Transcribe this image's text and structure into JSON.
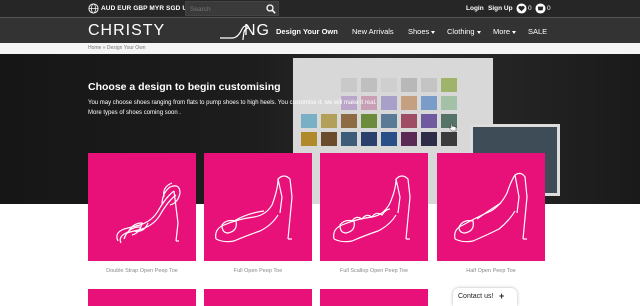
{
  "topbar": {
    "currencies": "AUD EUR GBP MYR SGD USD",
    "search_placeholder": "Search",
    "login": "Login",
    "signup": "Sign Up",
    "wishlist_count": "0",
    "cart_count": "0"
  },
  "brand": {
    "logo_prefix": "CHRISTY",
    "logo_suffix": "NG"
  },
  "nav": {
    "items": [
      {
        "label": "Design Your Own",
        "active": true
      },
      {
        "label": "New Arrivals"
      },
      {
        "label": "Shoes"
      },
      {
        "label": "Clothing"
      },
      {
        "label": "More"
      },
      {
        "label": "SALE"
      }
    ]
  },
  "breadcrumb": "Home » Design Your Own",
  "hero": {
    "title": "Choose a design to begin customising",
    "text": "You may choose shoes ranging from flats to pump shoes to high heels. You customise it, we will make it real. More types of shoes coming soon ."
  },
  "designs": [
    {
      "label": "Double Strap Open Peep Toe",
      "icon": "double-strap-sandal-icon"
    },
    {
      "label": "Full Open Peep Toe",
      "icon": "open-peep-toe-pump-icon"
    },
    {
      "label": "Full Scallop Open Peep Toe",
      "icon": "scallop-peep-toe-pump-icon"
    },
    {
      "label": "Half Open Peep Toe",
      "icon": "half-peep-toe-pump-icon"
    }
  ],
  "contact": {
    "label": "Contact us!",
    "plus": "+"
  },
  "colors": {
    "topbar": "#262626",
    "navbar": "#333333",
    "accent": "#e8117a"
  }
}
